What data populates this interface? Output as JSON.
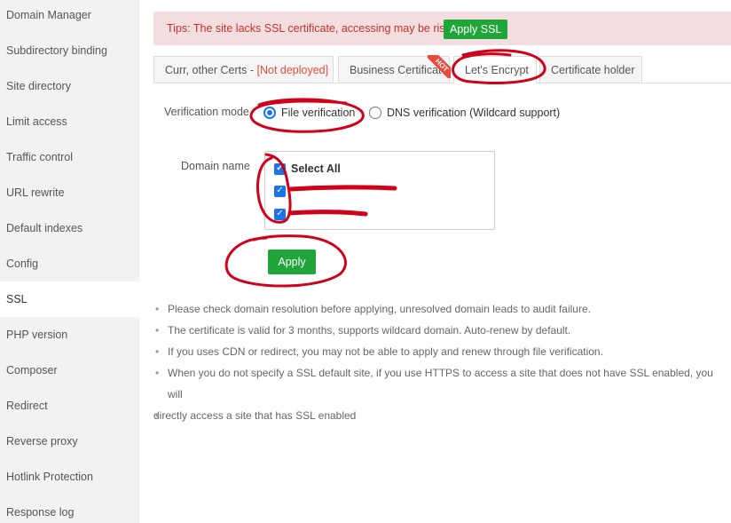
{
  "sidebar": {
    "items": [
      {
        "label": "Domain Manager"
      },
      {
        "label": "Subdirectory binding"
      },
      {
        "label": "Site directory"
      },
      {
        "label": "Limit access"
      },
      {
        "label": "Traffic control"
      },
      {
        "label": "URL rewrite"
      },
      {
        "label": "Default indexes"
      },
      {
        "label": "Config"
      },
      {
        "label": "SSL"
      },
      {
        "label": "PHP version"
      },
      {
        "label": "Composer"
      },
      {
        "label": "Redirect"
      },
      {
        "label": "Reverse proxy"
      },
      {
        "label": "Hotlink Protection"
      },
      {
        "label": "Response log"
      }
    ],
    "active": "SSL"
  },
  "tips": {
    "text": "Tips: The site lacks SSL certificate, accessing may be risky.",
    "button": "Apply SSL"
  },
  "tabs": {
    "curr_label": "Curr, other Certs - ",
    "curr_status": "[Not deployed]",
    "business": "Business Certificate",
    "hot_badge": "HOT",
    "letsencrypt": "Let's Encrypt",
    "holder": "Certificate holder",
    "active": "Let's Encrypt"
  },
  "form": {
    "verification_label": "Verification mode",
    "file_verification": "File verification",
    "dns_verification": "DNS verification (Wildcard support)",
    "selected_mode": "File verification",
    "domain_label": "Domain name",
    "select_all": "Select All",
    "apply_button": "Apply"
  },
  "notes": [
    "Please check domain resolution before applying, unresolved domain leads to audit failure.",
    "The certificate is valid for 3 months, supports wildcard domain. Auto-renew by default.",
    "If you uses CDN or redirect, you may not be able to apply and renew through file verification.",
    "When you do not specify a SSL default site, if you use HTTPS to access a site that does not have SSL enabled, you will",
    "directly access a site that has SSL enabled"
  ],
  "colors": {
    "accent_green": "#20a53a",
    "annotation_red": "#d0021b",
    "checkbox_blue": "#1a73e8",
    "tips_bg": "#f2dede",
    "tips_text": "#c9302c"
  }
}
